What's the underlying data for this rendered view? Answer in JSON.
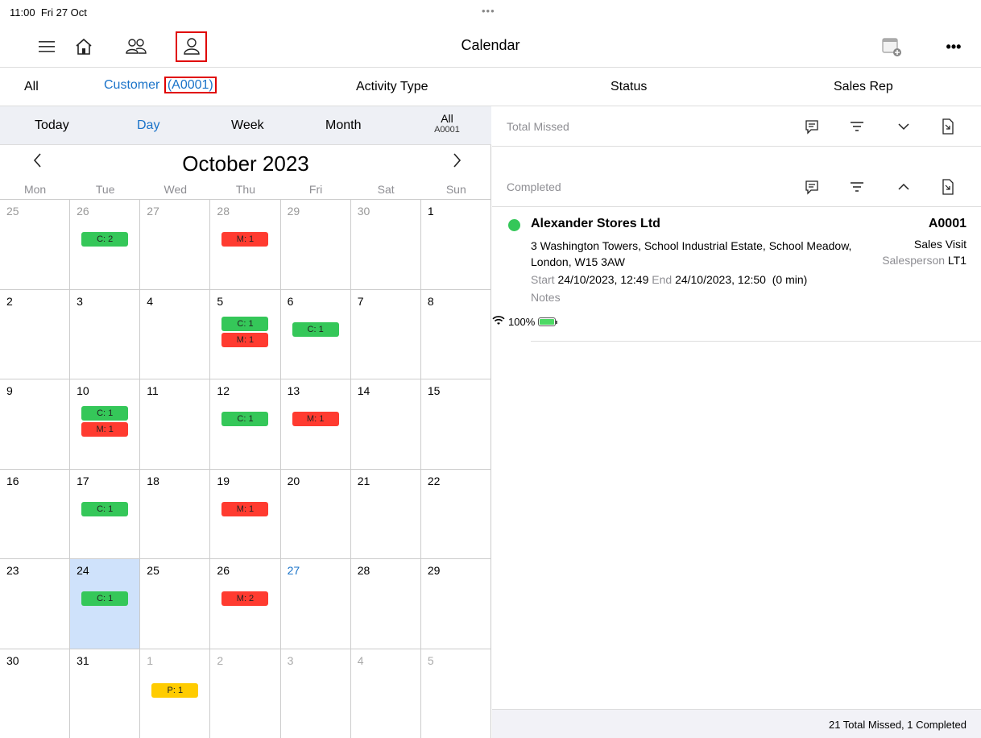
{
  "status_bar": {
    "time": "11:00",
    "date": "Fri 27 Oct",
    "battery": "100%",
    "dots": "•••"
  },
  "navbar": {
    "title": "Calendar",
    "more": "•••"
  },
  "filters": {
    "all": "All",
    "customer_label": "Customer",
    "customer_code": "(A0001)",
    "activity_type": "Activity Type",
    "status": "Status",
    "sales_rep": "Sales Rep"
  },
  "modes": {
    "today": "Today",
    "day": "Day",
    "week": "Week",
    "month": "Month",
    "all_top": "All",
    "all_sub": "A0001"
  },
  "calendar": {
    "month_title": "October 2023",
    "prev": "‹",
    "next": "›",
    "dows": [
      "Mon",
      "Tue",
      "Wed",
      "Thu",
      "Fri",
      "Sat",
      "Sun"
    ],
    "weeks": [
      [
        {
          "d": "25",
          "t": "dim",
          "b": []
        },
        {
          "d": "26",
          "t": "dim",
          "b": [
            [
              "C",
              "C: 2"
            ]
          ]
        },
        {
          "d": "27",
          "t": "dim",
          "b": []
        },
        {
          "d": "28",
          "t": "dim",
          "b": [
            [
              "M",
              "M: 1"
            ]
          ]
        },
        {
          "d": "29",
          "t": "dim",
          "b": []
        },
        {
          "d": "30",
          "t": "dim",
          "b": []
        },
        {
          "d": "1",
          "t": "",
          "b": []
        }
      ],
      [
        {
          "d": "2",
          "t": "",
          "b": []
        },
        {
          "d": "3",
          "t": "",
          "b": []
        },
        {
          "d": "4",
          "t": "",
          "b": []
        },
        {
          "d": "5",
          "t": "",
          "b": [
            [
              "C",
              "C: 1"
            ],
            [
              "M",
              "M: 1"
            ]
          ]
        },
        {
          "d": "6",
          "t": "",
          "b": [
            [
              "C",
              "C: 1"
            ]
          ]
        },
        {
          "d": "7",
          "t": "",
          "b": []
        },
        {
          "d": "8",
          "t": "",
          "b": []
        }
      ],
      [
        {
          "d": "9",
          "t": "",
          "b": []
        },
        {
          "d": "10",
          "t": "",
          "b": [
            [
              "C",
              "C: 1"
            ],
            [
              "M",
              "M: 1"
            ]
          ]
        },
        {
          "d": "11",
          "t": "",
          "b": []
        },
        {
          "d": "12",
          "t": "",
          "b": [
            [
              "C",
              "C: 1"
            ]
          ]
        },
        {
          "d": "13",
          "t": "",
          "b": [
            [
              "M",
              "M: 1"
            ]
          ]
        },
        {
          "d": "14",
          "t": "",
          "b": []
        },
        {
          "d": "15",
          "t": "",
          "b": []
        }
      ],
      [
        {
          "d": "16",
          "t": "",
          "b": []
        },
        {
          "d": "17",
          "t": "",
          "b": [
            [
              "C",
              "C: 1"
            ]
          ]
        },
        {
          "d": "18",
          "t": "",
          "b": []
        },
        {
          "d": "19",
          "t": "",
          "b": [
            [
              "M",
              "M: 1"
            ]
          ]
        },
        {
          "d": "20",
          "t": "",
          "b": []
        },
        {
          "d": "21",
          "t": "",
          "b": []
        },
        {
          "d": "22",
          "t": "",
          "b": []
        }
      ],
      [
        {
          "d": "23",
          "t": "",
          "b": []
        },
        {
          "d": "24",
          "t": "sel",
          "b": [
            [
              "C",
              "C: 1"
            ]
          ]
        },
        {
          "d": "25",
          "t": "",
          "b": []
        },
        {
          "d": "26",
          "t": "",
          "b": [
            [
              "M",
              "M: 2"
            ]
          ]
        },
        {
          "d": "27",
          "t": "today",
          "b": []
        },
        {
          "d": "28",
          "t": "",
          "b": []
        },
        {
          "d": "29",
          "t": "",
          "b": []
        }
      ],
      [
        {
          "d": "30",
          "t": "",
          "b": []
        },
        {
          "d": "31",
          "t": "",
          "b": []
        },
        {
          "d": "1",
          "t": "other",
          "b": [
            [
              "P",
              "P: 1"
            ]
          ]
        },
        {
          "d": "2",
          "t": "other",
          "b": []
        },
        {
          "d": "3",
          "t": "other",
          "b": []
        },
        {
          "d": "4",
          "t": "other",
          "b": []
        },
        {
          "d": "5",
          "t": "other",
          "b": []
        }
      ]
    ]
  },
  "sections": {
    "missed": "Total Missed",
    "completed": "Completed"
  },
  "entry": {
    "name": "Alexander Stores Ltd",
    "code": "A0001",
    "address": "3 Washington Towers, School Industrial Estate, School Meadow, London, W15 3AW",
    "type": "Sales Visit",
    "salesperson_label": "Salesperson",
    "salesperson": "LT1",
    "start_label": "Start",
    "start": "24/10/2023, 12:49",
    "end_label": "End",
    "end": "24/10/2023, 12:50",
    "duration": "(0 min)",
    "notes_label": "Notes"
  },
  "footer": "21 Total Missed, 1 Completed",
  "colors": {
    "accent": "#1a73c9",
    "completed": "#35c759",
    "missed": "#ff3b30",
    "planned": "#ffcc00",
    "highlight": "#e00000"
  }
}
